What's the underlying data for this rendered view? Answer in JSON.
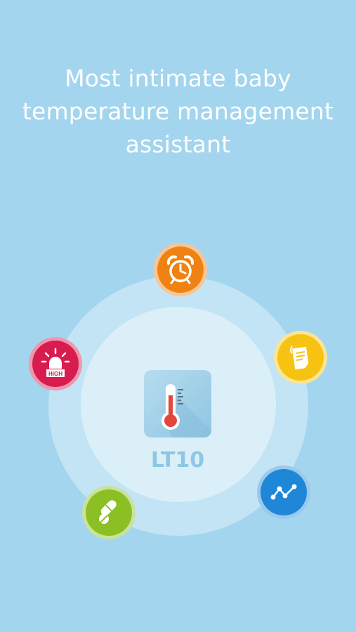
{
  "headline": {
    "line1": "Most intimate baby",
    "line2": "temperature management",
    "line3": "assistant"
  },
  "app": {
    "name": "LT10",
    "icon": "thermometer-icon"
  },
  "features": [
    {
      "id": "alarm",
      "icon": "alarm-clock-icon",
      "color": "#f08213"
    },
    {
      "id": "notes",
      "icon": "notes-icon",
      "color": "#f6c313"
    },
    {
      "id": "chart",
      "icon": "line-chart-icon",
      "color": "#1f87d7"
    },
    {
      "id": "medicine",
      "icon": "pills-icon",
      "color": "#8bbf23"
    },
    {
      "id": "high-alert",
      "icon": "alarm-light-icon",
      "color": "#d81c4f",
      "badge": "HIGH"
    }
  ]
}
